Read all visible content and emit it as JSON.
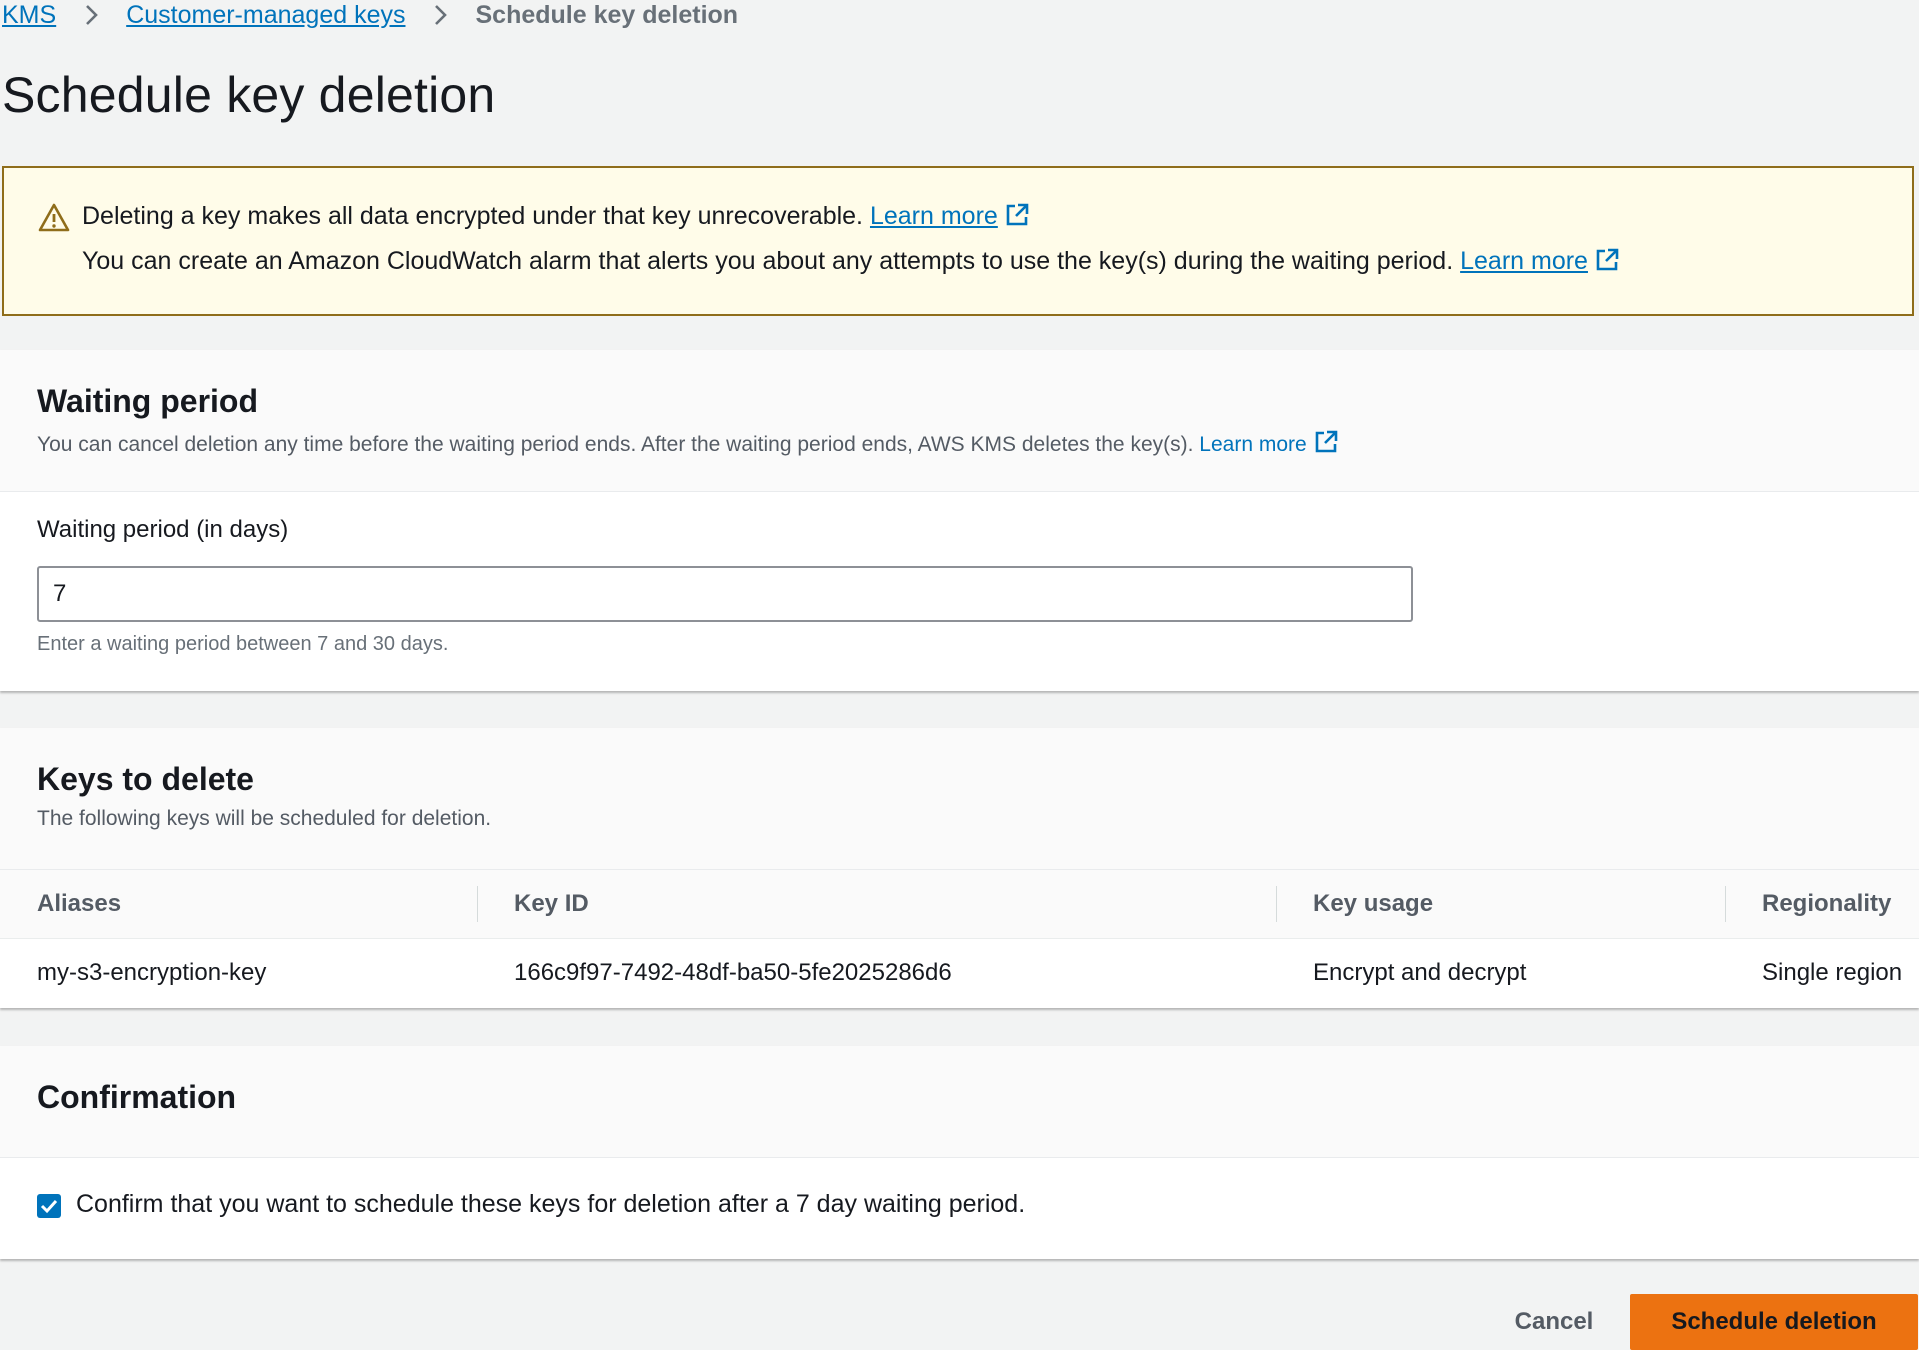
{
  "breadcrumb": {
    "items": [
      {
        "label": "KMS"
      },
      {
        "label": "Customer-managed keys"
      }
    ],
    "current": "Schedule key deletion"
  },
  "page_title": "Schedule key deletion",
  "alert": {
    "line1": "Deleting a key makes all data encrypted under that key unrecoverable.",
    "line1_link": "Learn more",
    "line2": "You can create an Amazon CloudWatch alarm that alerts you about any attempts to use the key(s) during the waiting period.",
    "line2_link": "Learn more",
    "icon": "warning-icon"
  },
  "waiting_period": {
    "title": "Waiting period",
    "description": "You can cancel deletion any time before the waiting period ends. After the waiting period ends, AWS KMS deletes the key(s).",
    "description_link": "Learn more",
    "field_label": "Waiting period (in days)",
    "value": "7",
    "hint": "Enter a waiting period between 7 and 30 days."
  },
  "keys_to_delete": {
    "title": "Keys to delete",
    "description": "The following keys will be scheduled for deletion.",
    "columns": [
      "Aliases",
      "Key ID",
      "Key usage",
      "Regionality"
    ],
    "rows": [
      {
        "alias": "my-s3-encryption-key",
        "key_id": "166c9f97-7492-48df-ba50-5fe2025286d6",
        "usage": "Encrypt and decrypt",
        "regionality": "Single region"
      }
    ]
  },
  "confirmation": {
    "title": "Confirmation",
    "checkbox_label": "Confirm that you want to schedule these keys for deletion after a 7 day waiting period.",
    "checked": true
  },
  "actions": {
    "cancel": "Cancel",
    "primary": "Schedule deletion"
  },
  "colors": {
    "link": "#0073bb",
    "primary_button": "#ec7211",
    "alert_bg": "#fffce9",
    "alert_border": "#8f6d1a",
    "checkbox": "#0073bb"
  }
}
